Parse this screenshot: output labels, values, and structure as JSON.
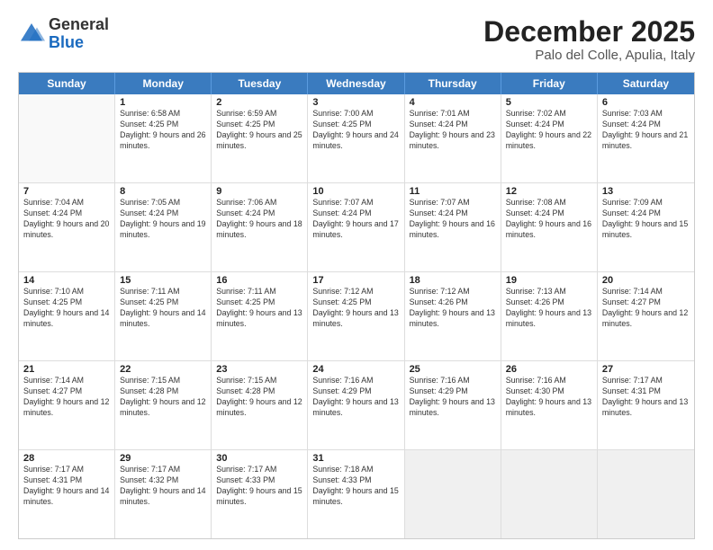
{
  "header": {
    "logo": {
      "general": "General",
      "blue": "Blue"
    },
    "title": "December 2025",
    "location": "Palo del Colle, Apulia, Italy"
  },
  "weekdays": [
    "Sunday",
    "Monday",
    "Tuesday",
    "Wednesday",
    "Thursday",
    "Friday",
    "Saturday"
  ],
  "weeks": [
    [
      {
        "day": "",
        "empty": true
      },
      {
        "day": "1",
        "sunrise": "6:58 AM",
        "sunset": "4:25 PM",
        "daylight": "9 hours and 26 minutes."
      },
      {
        "day": "2",
        "sunrise": "6:59 AM",
        "sunset": "4:25 PM",
        "daylight": "9 hours and 25 minutes."
      },
      {
        "day": "3",
        "sunrise": "7:00 AM",
        "sunset": "4:25 PM",
        "daylight": "9 hours and 24 minutes."
      },
      {
        "day": "4",
        "sunrise": "7:01 AM",
        "sunset": "4:24 PM",
        "daylight": "9 hours and 23 minutes."
      },
      {
        "day": "5",
        "sunrise": "7:02 AM",
        "sunset": "4:24 PM",
        "daylight": "9 hours and 22 minutes."
      },
      {
        "day": "6",
        "sunrise": "7:03 AM",
        "sunset": "4:24 PM",
        "daylight": "9 hours and 21 minutes."
      }
    ],
    [
      {
        "day": "7",
        "sunrise": "7:04 AM",
        "sunset": "4:24 PM",
        "daylight": "9 hours and 20 minutes."
      },
      {
        "day": "8",
        "sunrise": "7:05 AM",
        "sunset": "4:24 PM",
        "daylight": "9 hours and 19 minutes."
      },
      {
        "day": "9",
        "sunrise": "7:06 AM",
        "sunset": "4:24 PM",
        "daylight": "9 hours and 18 minutes."
      },
      {
        "day": "10",
        "sunrise": "7:07 AM",
        "sunset": "4:24 PM",
        "daylight": "9 hours and 17 minutes."
      },
      {
        "day": "11",
        "sunrise": "7:07 AM",
        "sunset": "4:24 PM",
        "daylight": "9 hours and 16 minutes."
      },
      {
        "day": "12",
        "sunrise": "7:08 AM",
        "sunset": "4:24 PM",
        "daylight": "9 hours and 16 minutes."
      },
      {
        "day": "13",
        "sunrise": "7:09 AM",
        "sunset": "4:24 PM",
        "daylight": "9 hours and 15 minutes."
      }
    ],
    [
      {
        "day": "14",
        "sunrise": "7:10 AM",
        "sunset": "4:25 PM",
        "daylight": "9 hours and 14 minutes."
      },
      {
        "day": "15",
        "sunrise": "7:11 AM",
        "sunset": "4:25 PM",
        "daylight": "9 hours and 14 minutes."
      },
      {
        "day": "16",
        "sunrise": "7:11 AM",
        "sunset": "4:25 PM",
        "daylight": "9 hours and 13 minutes."
      },
      {
        "day": "17",
        "sunrise": "7:12 AM",
        "sunset": "4:25 PM",
        "daylight": "9 hours and 13 minutes."
      },
      {
        "day": "18",
        "sunrise": "7:12 AM",
        "sunset": "4:26 PM",
        "daylight": "9 hours and 13 minutes."
      },
      {
        "day": "19",
        "sunrise": "7:13 AM",
        "sunset": "4:26 PM",
        "daylight": "9 hours and 13 minutes."
      },
      {
        "day": "20",
        "sunrise": "7:14 AM",
        "sunset": "4:27 PM",
        "daylight": "9 hours and 12 minutes."
      }
    ],
    [
      {
        "day": "21",
        "sunrise": "7:14 AM",
        "sunset": "4:27 PM",
        "daylight": "9 hours and 12 minutes."
      },
      {
        "day": "22",
        "sunrise": "7:15 AM",
        "sunset": "4:28 PM",
        "daylight": "9 hours and 12 minutes."
      },
      {
        "day": "23",
        "sunrise": "7:15 AM",
        "sunset": "4:28 PM",
        "daylight": "9 hours and 12 minutes."
      },
      {
        "day": "24",
        "sunrise": "7:16 AM",
        "sunset": "4:29 PM",
        "daylight": "9 hours and 13 minutes."
      },
      {
        "day": "25",
        "sunrise": "7:16 AM",
        "sunset": "4:29 PM",
        "daylight": "9 hours and 13 minutes."
      },
      {
        "day": "26",
        "sunrise": "7:16 AM",
        "sunset": "4:30 PM",
        "daylight": "9 hours and 13 minutes."
      },
      {
        "day": "27",
        "sunrise": "7:17 AM",
        "sunset": "4:31 PM",
        "daylight": "9 hours and 13 minutes."
      }
    ],
    [
      {
        "day": "28",
        "sunrise": "7:17 AM",
        "sunset": "4:31 PM",
        "daylight": "9 hours and 14 minutes."
      },
      {
        "day": "29",
        "sunrise": "7:17 AM",
        "sunset": "4:32 PM",
        "daylight": "9 hours and 14 minutes."
      },
      {
        "day": "30",
        "sunrise": "7:17 AM",
        "sunset": "4:33 PM",
        "daylight": "9 hours and 15 minutes."
      },
      {
        "day": "31",
        "sunrise": "7:18 AM",
        "sunset": "4:33 PM",
        "daylight": "9 hours and 15 minutes."
      },
      {
        "day": "",
        "empty": true
      },
      {
        "day": "",
        "empty": true
      },
      {
        "day": "",
        "empty": true
      }
    ]
  ]
}
